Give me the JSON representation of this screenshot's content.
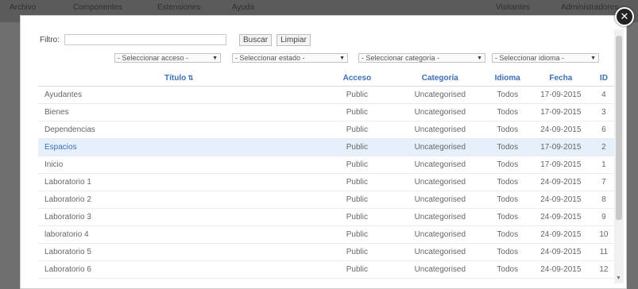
{
  "backdrop": {
    "menu": [
      "Archivo",
      "Componentes",
      "Extensiones",
      "Ayuda"
    ],
    "right": [
      "Visitantes",
      "Administradores"
    ]
  },
  "modal": {
    "close_label": "✕"
  },
  "filter": {
    "label": "Filtro:",
    "value": "",
    "search_label": "Buscar",
    "clear_label": "Limpiar"
  },
  "selects": {
    "access": "- Seleccionar acceso -",
    "state": "- Seleccionar estado -",
    "category": "- Seleccionar categoría -",
    "language": "- Seleccionar idioma -"
  },
  "table": {
    "headers": {
      "title": "Título",
      "access": "Acceso",
      "category": "Categoría",
      "language": "Idioma",
      "date": "Fecha",
      "id": "ID"
    },
    "rows": [
      {
        "title": "Ayudantes",
        "access": "Public",
        "category": "Uncategorised",
        "language": "Todos",
        "date": "17-09-2015",
        "id": "4"
      },
      {
        "title": "Bienes",
        "access": "Public",
        "category": "Uncategorised",
        "language": "Todos",
        "date": "17-09-2015",
        "id": "3"
      },
      {
        "title": "Dependencias",
        "access": "Public",
        "category": "Uncategorised",
        "language": "Todos",
        "date": "24-09-2015",
        "id": "6"
      },
      {
        "title": "Espacios",
        "access": "Public",
        "category": "Uncategorised",
        "language": "Todos",
        "date": "17-09-2015",
        "id": "2"
      },
      {
        "title": "Inicio",
        "access": "Public",
        "category": "Uncategorised",
        "language": "Todos",
        "date": "17-09-2015",
        "id": "1"
      },
      {
        "title": "Laboratorio 1",
        "access": "Public",
        "category": "Uncategorised",
        "language": "Todos",
        "date": "24-09-2015",
        "id": "7"
      },
      {
        "title": "Laboratorio 2",
        "access": "Public",
        "category": "Uncategorised",
        "language": "Todos",
        "date": "24-09-2015",
        "id": "8"
      },
      {
        "title": "Laboratorio 3",
        "access": "Public",
        "category": "Uncategorised",
        "language": "Todos",
        "date": "24-09-2015",
        "id": "9"
      },
      {
        "title": "laboratorio 4",
        "access": "Public",
        "category": "Uncategorised",
        "language": "Todos",
        "date": "24-09-2015",
        "id": "10"
      },
      {
        "title": "Laboratorio 5",
        "access": "Public",
        "category": "Uncategorised",
        "language": "Todos",
        "date": "24-09-2015",
        "id": "11"
      },
      {
        "title": "Laboratorio 6",
        "access": "Public",
        "category": "Uncategorised",
        "language": "Todos",
        "date": "24-09-2015",
        "id": "12"
      }
    ]
  },
  "colors": {
    "link": "#3b6fb3",
    "highlight_row": "#e6f0fb"
  }
}
